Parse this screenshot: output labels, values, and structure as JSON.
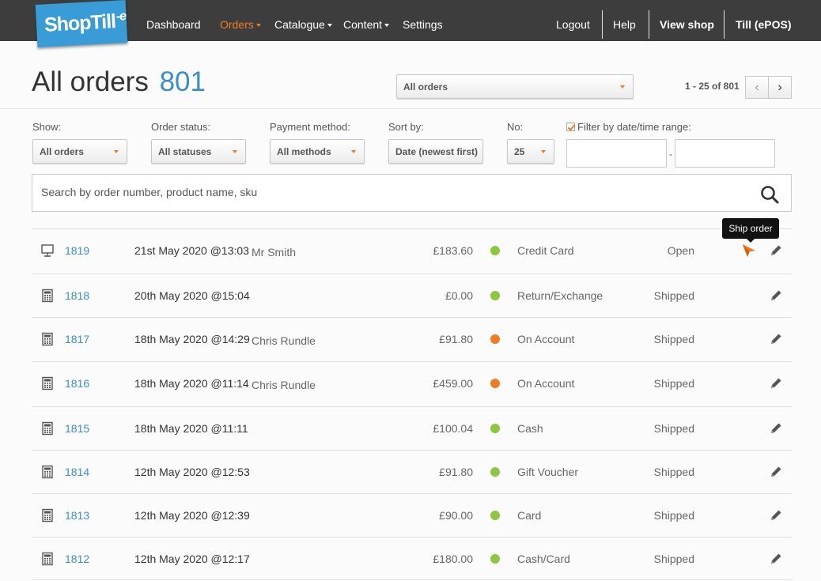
{
  "brand": {
    "logo_main": "ShopTill",
    "logo_suffix": "-e"
  },
  "nav": {
    "dashboard": "Dashboard",
    "orders": "Orders",
    "catalogue": "Catalogue",
    "content": "Content",
    "settings": "Settings",
    "logout": "Logout",
    "help": "Help",
    "view_shop": "View shop",
    "till": "Till (ePOS)"
  },
  "header": {
    "title": "All orders",
    "count": "801",
    "view_select": "All orders",
    "pager": "1 - 25 of 801",
    "prev_icon": "‹",
    "next_icon": "›"
  },
  "filters": {
    "show_label": "Show:",
    "show_value": "All orders",
    "status_label": "Order status:",
    "status_value": "All statuses",
    "payment_label": "Payment method:",
    "payment_value": "All methods",
    "sort_label": "Sort by:",
    "sort_value": "Date (newest first)",
    "no_label": "No:",
    "no_value": "25",
    "date_filter_label": "Filter by date/time range:",
    "date_separator": "-",
    "date_from": "",
    "date_to": ""
  },
  "search": {
    "placeholder": "Search by order number, product name, sku"
  },
  "tooltip": {
    "text": "Ship order"
  },
  "colors": {
    "accent": "#f07c21",
    "link": "#3a8fcb",
    "paid_dot": "#8dc63f",
    "account_dot": "#f07c21"
  },
  "orders": [
    {
      "icon": "monitor-icon",
      "number": "1819",
      "date": "21st May 2020 @13:03",
      "customer": "Mr Smith",
      "amount": "£183.60",
      "dot": "green",
      "method": "Credit Card",
      "status": "Open",
      "ship": true
    },
    {
      "icon": "calculator-icon",
      "number": "1818",
      "date": "20th May 2020 @15:04",
      "customer": "",
      "amount": "£0.00",
      "dot": "green",
      "method": "Return/Exchange",
      "status": "Shipped",
      "ship": false
    },
    {
      "icon": "calculator-icon",
      "number": "1817",
      "date": "18th May 2020 @14:29",
      "customer": "Chris Rundle",
      "amount": "£91.80",
      "dot": "orange",
      "method": "On Account",
      "status": "Shipped",
      "ship": false
    },
    {
      "icon": "calculator-icon",
      "number": "1816",
      "date": "18th May 2020 @11:14",
      "customer": "Chris Rundle",
      "amount": "£459.00",
      "dot": "orange",
      "method": "On Account",
      "status": "Shipped",
      "ship": false
    },
    {
      "icon": "calculator-icon",
      "number": "1815",
      "date": "18th May 2020 @11:11",
      "customer": "",
      "amount": "£100.04",
      "dot": "green",
      "method": "Cash",
      "status": "Shipped",
      "ship": false
    },
    {
      "icon": "calculator-icon",
      "number": "1814",
      "date": "12th May 2020 @12:53",
      "customer": "",
      "amount": "£91.80",
      "dot": "green",
      "method": "Gift Voucher",
      "status": "Shipped",
      "ship": false
    },
    {
      "icon": "calculator-icon",
      "number": "1813",
      "date": "12th May 2020 @12:39",
      "customer": "",
      "amount": "£90.00",
      "dot": "green",
      "method": "Card",
      "status": "Shipped",
      "ship": false
    },
    {
      "icon": "calculator-icon",
      "number": "1812",
      "date": "12th May 2020 @12:17",
      "customer": "",
      "amount": "£180.00",
      "dot": "green",
      "method": "Cash/Card",
      "status": "Shipped",
      "ship": false
    }
  ]
}
